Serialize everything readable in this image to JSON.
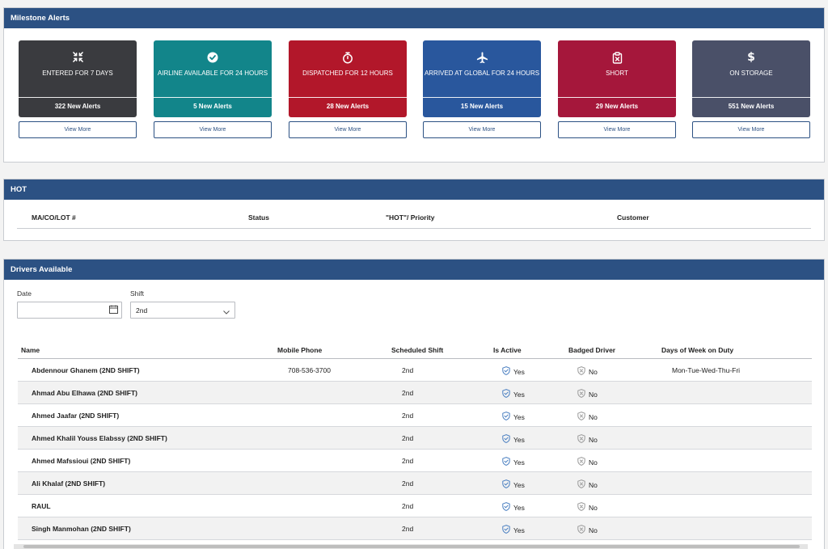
{
  "milestone": {
    "title": "Milestone Alerts",
    "cards": [
      {
        "title": "ENTERED FOR 7 DAYS",
        "count": "322 New Alerts",
        "color": "#3a3b3f",
        "icon": "compress-arrows-icon"
      },
      {
        "title": "AIRLINE AVAILABLE FOR 24 HOURS",
        "count": "5 New Alerts",
        "color": "#12858a",
        "icon": "check-circle-icon"
      },
      {
        "title": "DISPATCHED FOR 12 HOURS",
        "count": "28 New Alerts",
        "color": "#b2172a",
        "icon": "stopwatch-icon"
      },
      {
        "title": "ARRIVED AT GLOBAL FOR 24 HOURS",
        "count": "15 New Alerts",
        "color": "#29579d",
        "icon": "airplane-icon"
      },
      {
        "title": "SHORT",
        "count": "29 New Alerts",
        "color": "#a5173b",
        "icon": "clipboard-x-icon"
      },
      {
        "title": "ON STORAGE",
        "count": "551 New Alerts",
        "color": "#4a5068",
        "icon": "dollar-icon"
      }
    ],
    "view_more_label": "View More"
  },
  "hot": {
    "title": "HOT",
    "columns": [
      "MA/CO/LOT #",
      "Status",
      "\"HOT\"/ Priority",
      "Customer"
    ]
  },
  "drivers": {
    "title": "Drivers Available",
    "date_label": "Date",
    "date_value": "",
    "shift_label": "Shift",
    "shift_value": "2nd",
    "columns": [
      "Name",
      "Mobile Phone",
      "Scheduled Shift",
      "Is Active",
      "Badged Driver",
      "Days of Week on Duty"
    ],
    "rows": [
      {
        "name": "Abdennour Ghanem (2ND SHIFT)",
        "phone": "708-536-3700",
        "shift": "2nd",
        "active": "Yes",
        "badged": "No",
        "days": "Mon-Tue-Wed-Thu-Fri"
      },
      {
        "name": "Ahmad Abu Elhawa (2ND SHIFT)",
        "phone": "",
        "shift": "2nd",
        "active": "Yes",
        "badged": "No",
        "days": ""
      },
      {
        "name": "Ahmed Jaafar (2ND SHIFT)",
        "phone": "",
        "shift": "2nd",
        "active": "Yes",
        "badged": "No",
        "days": ""
      },
      {
        "name": "Ahmed Khalil Youss Elabssy (2ND SHIFT)",
        "phone": "",
        "shift": "2nd",
        "active": "Yes",
        "badged": "No",
        "days": ""
      },
      {
        "name": "Ahmed Mafssioui (2ND SHIFT)",
        "phone": "",
        "shift": "2nd",
        "active": "Yes",
        "badged": "No",
        "days": ""
      },
      {
        "name": "Ali Khalaf (2ND SHIFT)",
        "phone": "",
        "shift": "2nd",
        "active": "Yes",
        "badged": "No",
        "days": ""
      },
      {
        "name": "RAUL",
        "phone": "",
        "shift": "2nd",
        "active": "Yes",
        "badged": "No",
        "days": ""
      },
      {
        "name": "Singh Manmohan (2ND SHIFT)",
        "phone": "",
        "shift": "2nd",
        "active": "Yes",
        "badged": "No",
        "days": ""
      }
    ]
  }
}
